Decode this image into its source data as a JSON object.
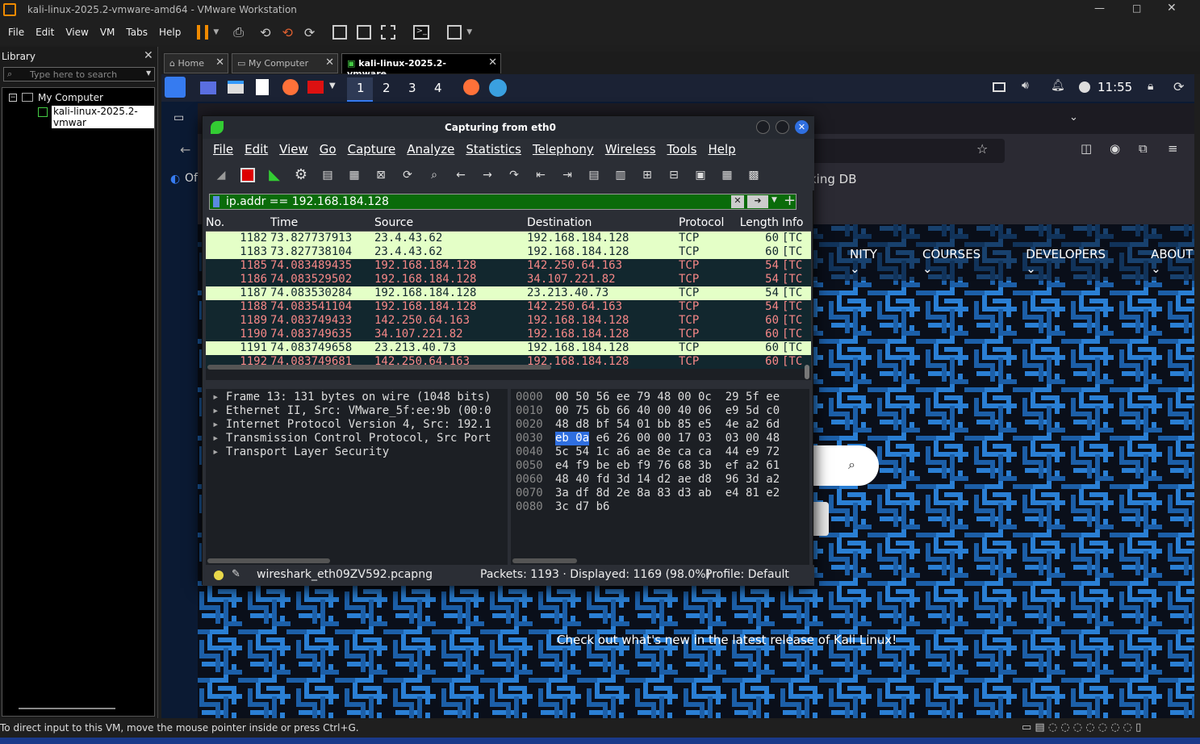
{
  "vmware": {
    "title": "kali-linux-2025.2-vmware-amd64 - VMware Workstation",
    "menu": [
      "File",
      "Edit",
      "View",
      "VM",
      "Tabs",
      "Help"
    ],
    "library_title": "Library",
    "search_placeholder": "Type here to search",
    "tree": {
      "root": "My Computer",
      "child": "kali-linux-2025.2-vmwar"
    },
    "tabs": [
      "Home",
      "My Computer",
      "kali-linux-2025.2-vmware..."
    ],
    "status": "To direct input to this VM, move the mouse pointer inside or press Ctrl+G."
  },
  "kali_panel": {
    "workspaces": [
      "1",
      "2",
      "3",
      "4"
    ],
    "clock": "11:55"
  },
  "browser": {
    "bookmark_partial_left": "Of",
    "bookmark_partial_right": "king DB",
    "nav": [
      "NITY",
      "COURSES",
      "DEVELOPERS",
      "ABOUT"
    ],
    "tagline": "Check out what's new in the latest release of Kali Linux!"
  },
  "wireshark": {
    "title": "Capturing from eth0",
    "menu": [
      "File",
      "Edit",
      "View",
      "Go",
      "Capture",
      "Analyze",
      "Statistics",
      "Telephony",
      "Wireless",
      "Tools",
      "Help"
    ],
    "filter": "ip.addr == 192.168.184.128",
    "columns": [
      "No.",
      "Time",
      "Source",
      "Destination",
      "Protocol",
      "Length",
      "Info"
    ],
    "packets": [
      {
        "no": "1182",
        "time": "73.827737913",
        "src": "23.4.43.62",
        "dst": "192.168.184.128",
        "proto": "TCP",
        "len": "60",
        "info": "[TC",
        "style": "g"
      },
      {
        "no": "1183",
        "time": "73.827738104",
        "src": "23.4.43.62",
        "dst": "192.168.184.128",
        "proto": "TCP",
        "len": "60",
        "info": "[TC",
        "style": "g"
      },
      {
        "no": "1185",
        "time": "74.083489435",
        "src": "192.168.184.128",
        "dst": "142.250.64.163",
        "proto": "TCP",
        "len": "54",
        "info": "[TC",
        "style": "r"
      },
      {
        "no": "1186",
        "time": "74.083529502",
        "src": "192.168.184.128",
        "dst": "34.107.221.82",
        "proto": "TCP",
        "len": "54",
        "info": "[TC",
        "style": "r"
      },
      {
        "no": "1187",
        "time": "74.083530284",
        "src": "192.168.184.128",
        "dst": "23.213.40.73",
        "proto": "TCP",
        "len": "54",
        "info": "[TC",
        "style": "g"
      },
      {
        "no": "1188",
        "time": "74.083541104",
        "src": "192.168.184.128",
        "dst": "142.250.64.163",
        "proto": "TCP",
        "len": "54",
        "info": "[TC",
        "style": "r"
      },
      {
        "no": "1189",
        "time": "74.083749433",
        "src": "142.250.64.163",
        "dst": "192.168.184.128",
        "proto": "TCP",
        "len": "60",
        "info": "[TC",
        "style": "r"
      },
      {
        "no": "1190",
        "time": "74.083749635",
        "src": "34.107.221.82",
        "dst": "192.168.184.128",
        "proto": "TCP",
        "len": "60",
        "info": "[TC",
        "style": "r"
      },
      {
        "no": "1191",
        "time": "74.083749658",
        "src": "23.213.40.73",
        "dst": "192.168.184.128",
        "proto": "TCP",
        "len": "60",
        "info": "[TC",
        "style": "g"
      },
      {
        "no": "1192",
        "time": "74.083749681",
        "src": "142.250.64.163",
        "dst": "192.168.184.128",
        "proto": "TCP",
        "len": "60",
        "info": "[TC",
        "style": "r"
      }
    ],
    "details": [
      "Frame 13: 131 bytes on wire (1048 bits)",
      "Ethernet II, Src: VMware_5f:ee:9b (00:0",
      "Internet Protocol Version 4, Src: 192.1",
      "Transmission Control Protocol, Src Port",
      "Transport Layer Security"
    ],
    "hex": [
      {
        "off": "0000",
        "bytes": "00 50 56 ee 79 48 00 0c  29 5f ee"
      },
      {
        "off": "0010",
        "bytes": "00 75 6b 66 40 00 40 06  e9 5d c0"
      },
      {
        "off": "0020",
        "bytes": "48 d8 bf 54 01 bb 85 e5  4e a2 6d"
      },
      {
        "off": "0030",
        "sel": "eb 0a",
        "bytes": " e6 26 00 00 17 03  03 00 48"
      },
      {
        "off": "0040",
        "bytes": "5c 54 1c a6 ae 8e ca ca  44 e9 72"
      },
      {
        "off": "0050",
        "bytes": "e4 f9 be eb f9 76 68 3b  ef a2 61"
      },
      {
        "off": "0060",
        "bytes": "48 40 fd 3d 14 d2 ae d8  96 3d a2"
      },
      {
        "off": "0070",
        "bytes": "3a df 8d 2e 8a 83 d3 ab  e4 81 e2"
      },
      {
        "off": "0080",
        "bytes": "3c d7 b6"
      }
    ],
    "status": {
      "file": "wireshark_eth09ZV592.pcapng",
      "packets": "Packets: 1193 · Displayed: 1169 (98.0%)",
      "profile": "Profile: Default"
    }
  },
  "colors": {
    "maze_blue": "#2a7fd4",
    "maze_dark": "#0a0f1a",
    "green_row": "#e4ffc7",
    "red_row_bg": "#12272e",
    "red_row_text": "#f78787",
    "filter_bg": "#0a6b0a"
  }
}
